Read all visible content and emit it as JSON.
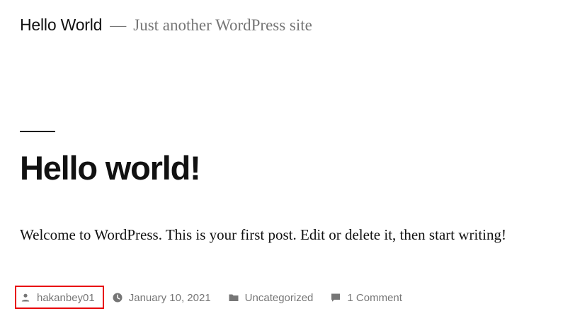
{
  "site": {
    "title": "Hello World",
    "separator": "—",
    "description": "Just another WordPress site"
  },
  "post": {
    "title": "Hello world!",
    "content": "Welcome to WordPress. This is your first post. Edit or delete it, then start writing!"
  },
  "meta": {
    "author": "hakanbey01",
    "date": "January 10, 2021",
    "category": "Uncategorized",
    "comments": "1 Comment"
  },
  "icons": {
    "author": "user-icon",
    "date": "clock-icon",
    "category": "folder-icon",
    "comments": "comment-icon"
  },
  "colors": {
    "text": "#111111",
    "meta_text": "#767676",
    "highlight": "#e8000a"
  }
}
